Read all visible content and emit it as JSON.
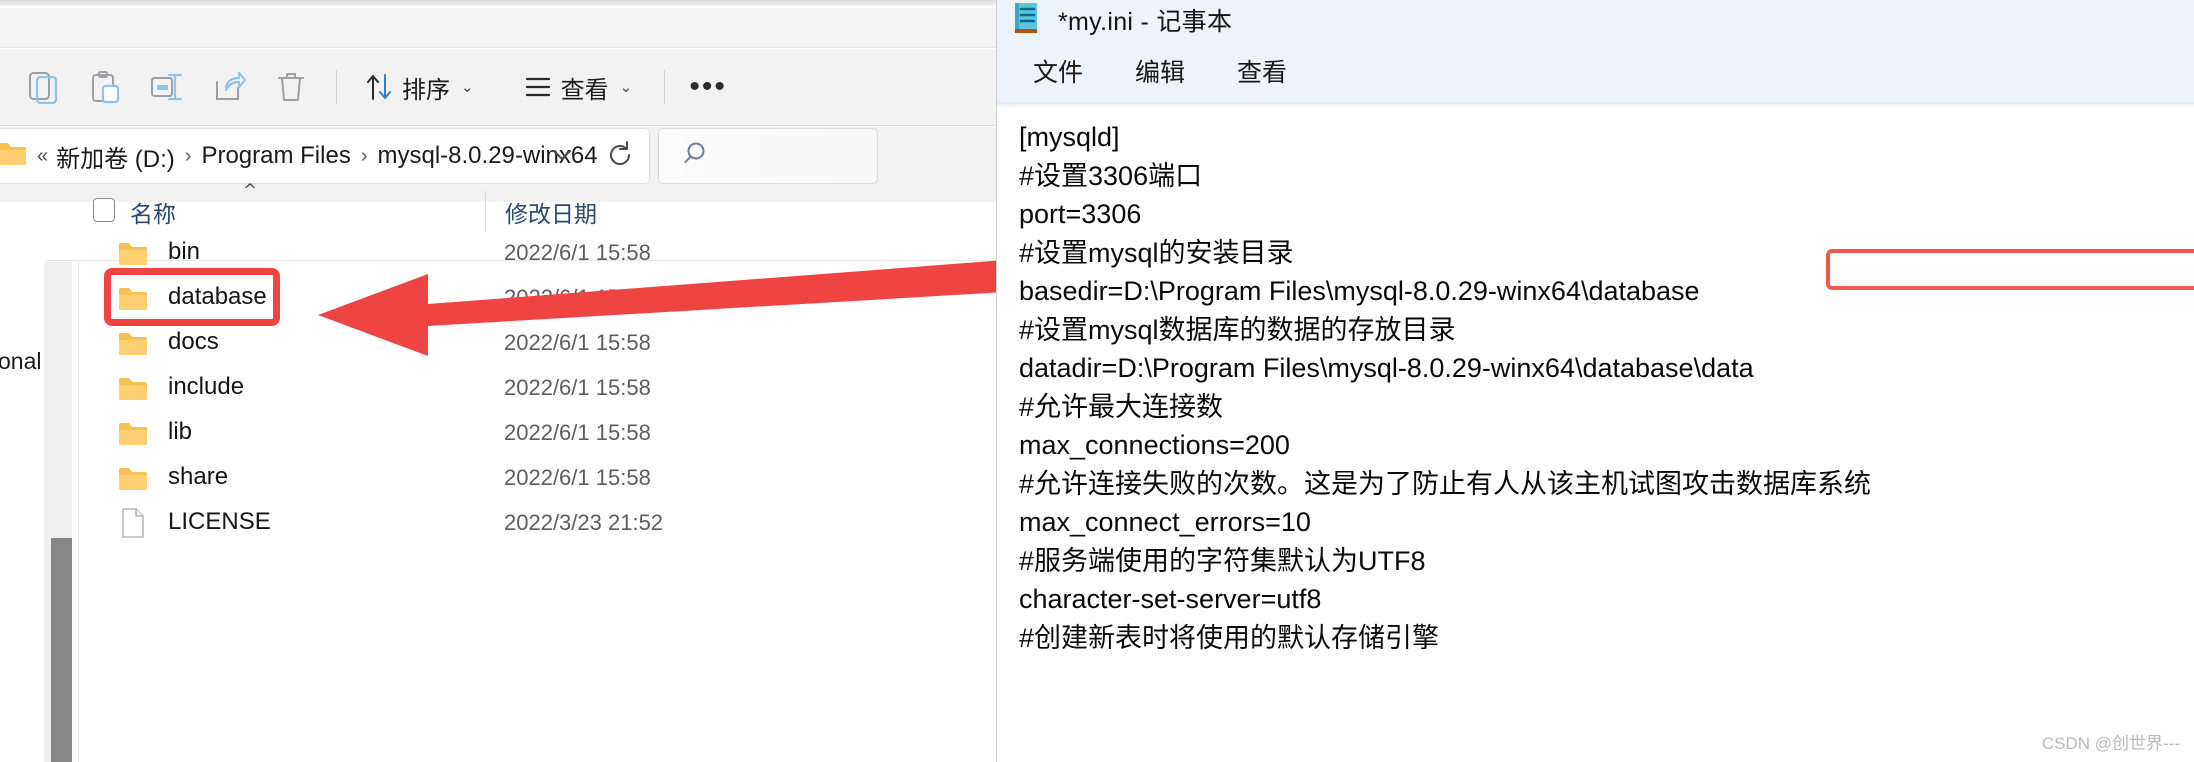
{
  "explorer": {
    "toolbar": {
      "icons": [
        {
          "name": "copy-icon",
          "label": "复制"
        },
        {
          "name": "paste-icon",
          "label": "粘贴"
        },
        {
          "name": "rename-icon",
          "label": "重命名"
        },
        {
          "name": "share-icon",
          "label": "共享"
        },
        {
          "name": "delete-icon",
          "label": "删除"
        }
      ],
      "sort_label": "排序",
      "view_label": "查看",
      "more_label": "•••"
    },
    "address": {
      "lead": "«",
      "crumbs": [
        "新加卷 (D:)",
        "Program Files",
        "mysql-8.0.29-winx64"
      ],
      "separator": "›",
      "dropdown_icon": "chevron-down-icon",
      "refresh_icon": "refresh-icon"
    },
    "search": {
      "icon": "search-icon",
      "placeholder": ""
    },
    "columns": {
      "name": "名称",
      "date_modified": "修改日期"
    },
    "rows": [
      {
        "name": "bin",
        "type": "folder",
        "date": "2022/6/1 15:58"
      },
      {
        "name": "database",
        "type": "folder",
        "date": "2022/6/1 17:05"
      },
      {
        "name": "docs",
        "type": "folder",
        "date": "2022/6/1 15:58"
      },
      {
        "name": "include",
        "type": "folder",
        "date": "2022/6/1 15:58"
      },
      {
        "name": "lib",
        "type": "folder",
        "date": "2022/6/1 15:58"
      },
      {
        "name": "share",
        "type": "folder",
        "date": "2022/6/1 15:58"
      },
      {
        "name": "LICENSE",
        "type": "file",
        "date": "2022/3/23 21:52"
      }
    ],
    "bleed_text": "onal"
  },
  "notepad": {
    "icon": "notepad-icon",
    "title": "*my.ini - 记事本",
    "menu": [
      "文件",
      "编辑",
      "查看"
    ],
    "content": "[mysqld]\n#设置3306端口\nport=3306\n#设置mysql的安装目录\nbasedir=D:\\Program Files\\mysql-8.0.29-winx64\\database\n#设置mysql数据库的数据的存放目录\ndatadir=D:\\Program Files\\mysql-8.0.29-winx64\\database\\data\n#允许最大连接数\nmax_connections=200\n#允许连接失败的次数。这是为了防止有人从该主机试图攻击数据库系统\nmax_connect_errors=10\n#服务端使用的字符集默认为UTF8\ncharacter-set-server=utf8\n#创建新表时将使用的默认存储引擎"
  },
  "annotations": {
    "highlight_color": "#ef4444",
    "arrow_name": "red-pointer-arrow",
    "explorer_highlight_target": "database",
    "notepad_highlight_target": "D:\\Program Files\\mysql-8.0.29-winx64\\database"
  },
  "watermark": "CSDN @创世界---"
}
